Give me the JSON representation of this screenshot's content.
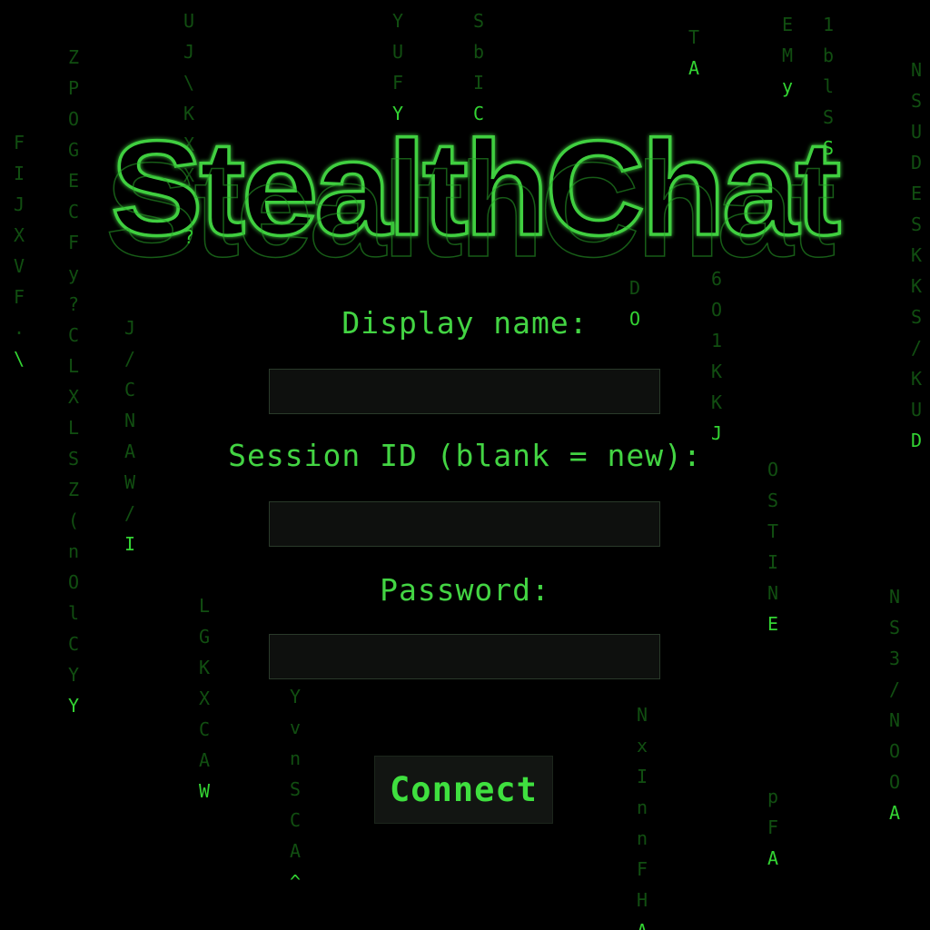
{
  "app": {
    "logo_text": "StealthChat"
  },
  "form": {
    "display_name": {
      "label": "Display name:",
      "value": ""
    },
    "session_id": {
      "label": "Session ID (blank = new):",
      "value": ""
    },
    "password": {
      "label": "Password:",
      "value": ""
    },
    "connect_label": "Connect"
  },
  "theme": {
    "accent": "#3fcf3f",
    "background": "#000000",
    "input_background": "#0e100e"
  },
  "rain": [
    {
      "chars": [
        "F",
        "I",
        "J",
        "X",
        "V",
        "F",
        ".",
        "\\"
      ]
    },
    {
      "chars": [
        "Z",
        "P",
        "O",
        "G",
        "E",
        "C",
        "F",
        "y",
        "?",
        "C",
        "L",
        "X",
        "L",
        "S",
        "Z",
        "(",
        "n",
        "O",
        "l",
        "C",
        "Y",
        "Y"
      ]
    },
    {
      "chars": [
        "J",
        "/",
        "C",
        "N",
        "A",
        "W",
        "/",
        "I"
      ]
    },
    {
      "chars": [
        "U",
        "J",
        "\\",
        "K",
        "X",
        "X",
        "6",
        "?"
      ]
    },
    {
      "chars": [
        "L",
        "G",
        "K",
        "X",
        "C",
        "A",
        "W"
      ]
    },
    {
      "chars": [
        "Y",
        "v",
        "n",
        "S",
        "C",
        "A",
        "^"
      ]
    },
    {
      "chars": [
        "Y",
        "U",
        "F",
        "Y"
      ]
    },
    {
      "chars": [
        "S",
        "b",
        "I",
        "C"
      ]
    },
    {
      "chars": [
        "D",
        "O"
      ]
    },
    {
      "chars": [
        "N",
        "x",
        "I",
        "n",
        "n",
        "F",
        "H",
        "A"
      ]
    },
    {
      "chars": [
        "T",
        "A"
      ]
    },
    {
      "chars": [
        "6",
        "O",
        "1",
        "K",
        "K",
        "J"
      ]
    },
    {
      "chars": [
        "O",
        "S",
        "T",
        "I",
        "N",
        "E"
      ]
    },
    {
      "chars": [
        "p",
        "F",
        "A"
      ]
    },
    {
      "chars": [
        "E",
        "M",
        "y"
      ]
    },
    {
      "chars": [
        "1",
        "b",
        "l",
        "S",
        "S"
      ]
    },
    {
      "chars": [
        "N",
        "S",
        "U",
        "D",
        "E",
        "S",
        "K",
        "K",
        "S",
        "/",
        "K",
        "U",
        "D"
      ]
    },
    {
      "chars": [
        "N",
        "S",
        "3",
        "/",
        "N",
        "O",
        "O",
        "A"
      ]
    }
  ]
}
